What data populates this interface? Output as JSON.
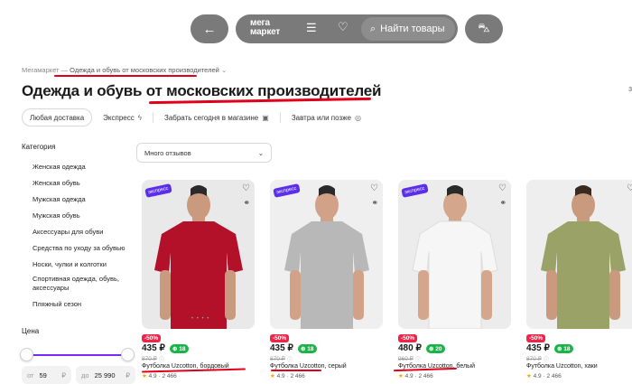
{
  "nav": {
    "back_icon": "←",
    "logo_line1": "мега",
    "logo_line2": "маркет",
    "menu_icon": "☰",
    "heart_icon": "♡",
    "search_icon": "⌕",
    "search_label": "Найти товары",
    "cart_icon": "⛍"
  },
  "breadcrumb": {
    "root": "Мегамаркет",
    "sep": "—",
    "current": "Одежда и обувь от московских производителей",
    "chevron": "⌄"
  },
  "page": {
    "title": "Одежда и обувь от московских производителей",
    "count": "3"
  },
  "tabs": [
    {
      "label": "Любая доставка",
      "icon": ""
    },
    {
      "label": "Экспресс",
      "icon": "ϟ"
    },
    {
      "label": "Забрать сегодня в магазине",
      "icon": "▣"
    },
    {
      "label": "Завтра или позже",
      "icon": "◎"
    }
  ],
  "sidebar": {
    "category_heading": "Категория",
    "categories": [
      "Женская одежда",
      "Женская обувь",
      "Мужская одежда",
      "Мужская обувь",
      "Аксессуары для обуви",
      "Средства по уходу за обувью",
      "Носки, чулки и колготки",
      "Спортивная одежда, обувь, аксессуары",
      "Пляжный сезон"
    ],
    "price_heading": "Цена",
    "price_from_label": "от",
    "price_from": "59",
    "price_to_label": "до",
    "price_to": "25 990",
    "currency": "₽"
  },
  "sort": {
    "label": "Много отзывов",
    "chevron": "⌄"
  },
  "products": [
    {
      "badge": "экспресс",
      "discount": "-50%",
      "price": "435 ₽",
      "bonus": "18",
      "old_price": "870 ₽",
      "name": "Футболка Uzcotton, бордовый",
      "rating": "4.9",
      "reviews": "2 466",
      "shirt_color": "#b3102a",
      "bg_color": "#e9e9e9",
      "dots": "• • • •"
    },
    {
      "badge": "экспресс",
      "discount": "-50%",
      "price": "435 ₽",
      "bonus": "18",
      "old_price": "870 ₽",
      "name": "Футболка Uzcotton, серый",
      "rating": "4.9",
      "reviews": "2 466",
      "shirt_color": "#b8b8b8",
      "bg_color": "#efefef",
      "dots": ""
    },
    {
      "badge": "экспресс",
      "discount": "-50%",
      "price": "480 ₽",
      "bonus": "20",
      "old_price": "960 ₽",
      "name": "Футболка Uzcotton, белый",
      "rating": "4.9",
      "reviews": "2 466",
      "shirt_color": "#f6f6f6",
      "bg_color": "#ececec",
      "dots": ""
    },
    {
      "badge": "",
      "discount": "-50%",
      "price": "435 ₽",
      "bonus": "18",
      "old_price": "870 ₽",
      "name": "Футболка Uzcotton, хаки",
      "rating": "4.9",
      "reviews": "2 466",
      "shirt_color": "#9ba268",
      "bg_color": "#eeeeee",
      "dots": ""
    }
  ],
  "annotation_color": "#e0001a"
}
